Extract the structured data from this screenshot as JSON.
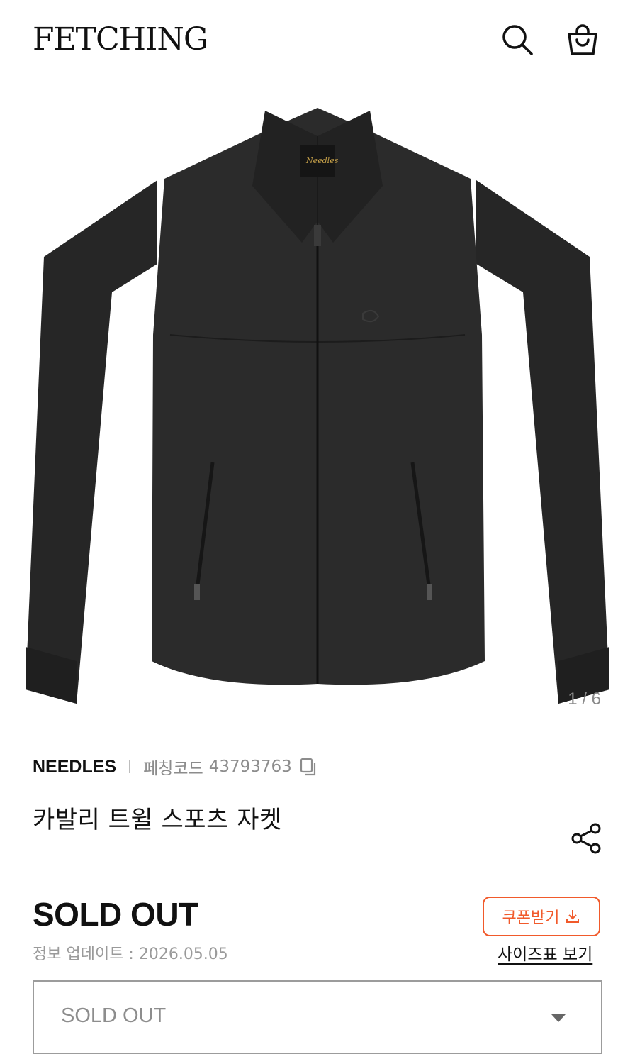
{
  "header": {
    "logo": "FETCHING",
    "icons": {
      "search": "search-icon",
      "cart": "shopping-bag-icon"
    }
  },
  "gallery": {
    "counter": "1 / 6",
    "current_page": 1,
    "total_pages": 6,
    "garment_label_text": "Needles"
  },
  "product": {
    "brand": "NEEDLES",
    "code_label": "페칭코드",
    "code_value": "43793763",
    "title": "카발리 트윌 스포츠 자켓",
    "price": "SOLD OUT",
    "updated": "정보 업데이트 : 2026.05.05"
  },
  "actions": {
    "coupon_label": "쿠폰받기",
    "size_chart_label": "사이즈표 보기"
  },
  "option_select": {
    "selected": "SOLD OUT"
  },
  "colors": {
    "accent": "#f15a2b",
    "text": "#111111",
    "muted": "#8c8c8c",
    "jacket": "#2a2a2a"
  }
}
